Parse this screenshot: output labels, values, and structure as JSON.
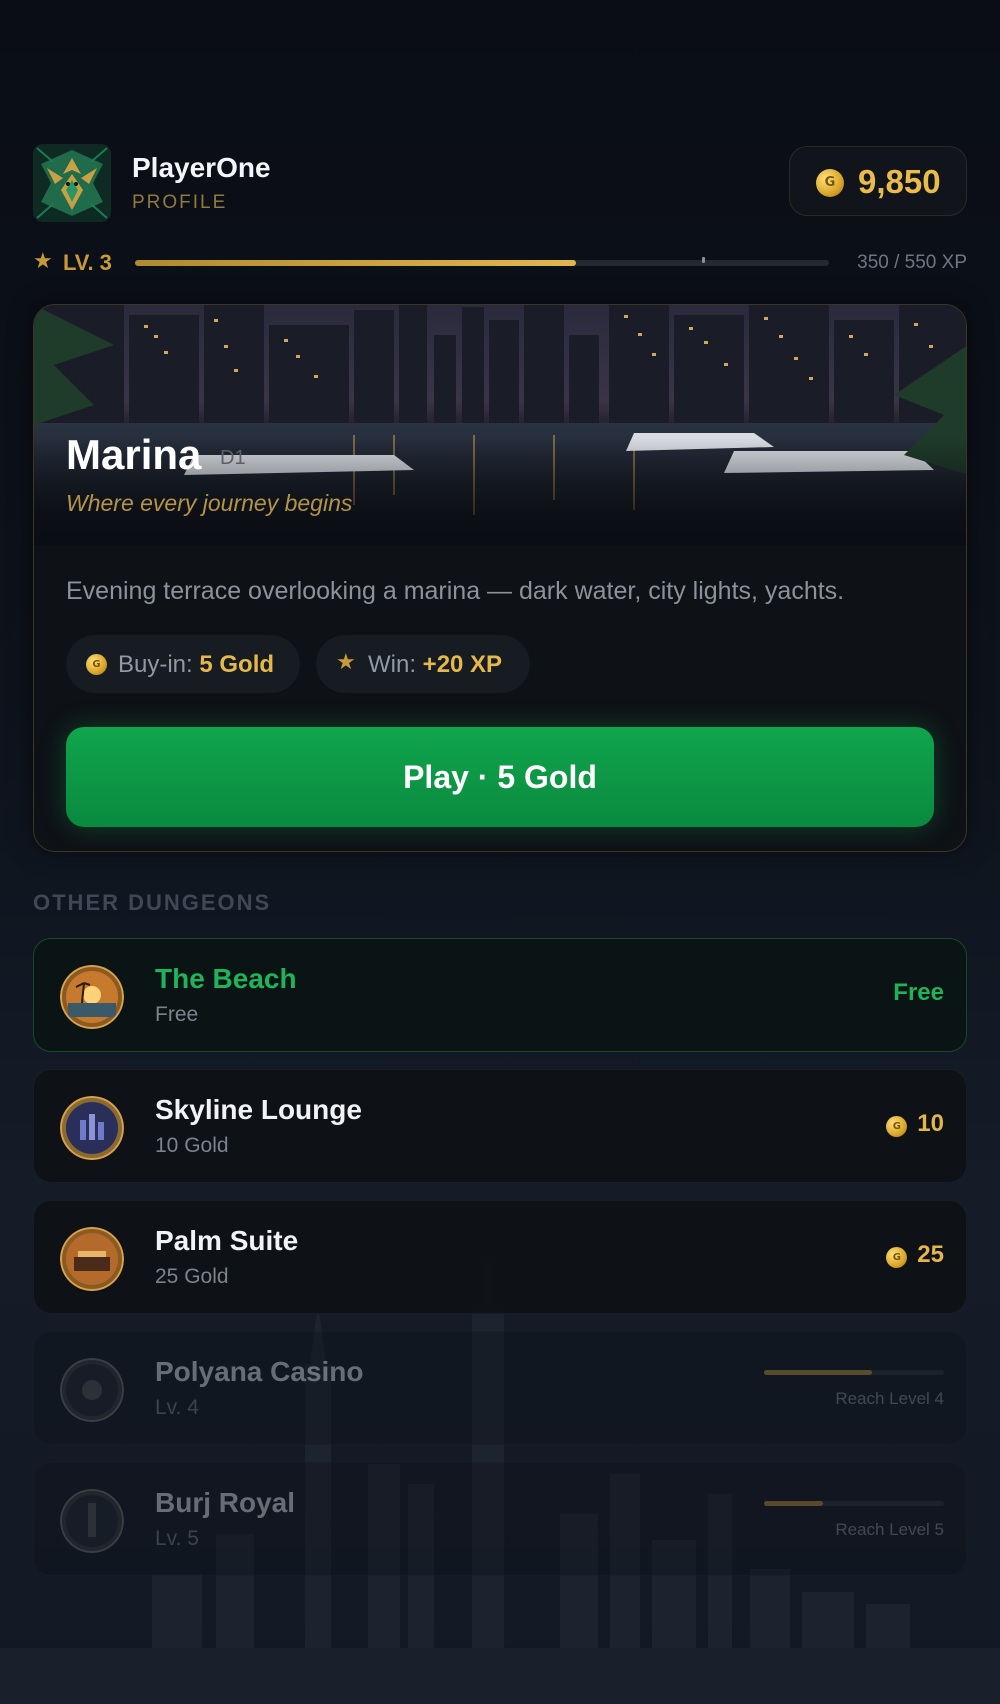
{
  "header": {
    "player_name": "PlayerOne",
    "profile_label": "PROFILE",
    "gold": "9,850",
    "coin_letter": "G",
    "avatar_icon": "eagle-emblem-icon"
  },
  "xp": {
    "level_label": "LV. 3",
    "current": 350,
    "max": 550,
    "progress_text": "350 / 550 XP",
    "fill_fraction": 0.636
  },
  "featured": {
    "title": "Marina",
    "tag": "D1",
    "subtitle": "Where every journey begins",
    "description": "Evening terrace overlooking a marina — dark water, city lights, yachts.",
    "buyin_label": "Buy-in:",
    "buyin_value": "5 Gold",
    "win_label": "Win:",
    "win_value": "+20 XP",
    "play_button": "Play · 5 Gold"
  },
  "section_title": "OTHER DUNGEONS",
  "dungeons": [
    {
      "name": "The Beach",
      "sub": "Free",
      "price": "Free",
      "state": "active"
    },
    {
      "name": "Skyline Lounge",
      "sub": "10 Gold",
      "price": "10",
      "state": "available"
    },
    {
      "name": "Palm Suite",
      "sub": "25 Gold",
      "price": "25",
      "state": "available"
    },
    {
      "name": "Polyana Casino",
      "sub": "Lv. 4",
      "lock_text": "Reach Level 4",
      "progress": 0.6,
      "state": "locked"
    },
    {
      "name": "Burj Royal",
      "sub": "Lv. 5",
      "lock_text": "Reach Level 5",
      "progress": 0.33,
      "state": "locked"
    }
  ],
  "colors": {
    "accent_gold": "#e2b64a",
    "play_green": "#0a9a45",
    "free_green": "#1db45a",
    "background": "#0a0d15"
  }
}
